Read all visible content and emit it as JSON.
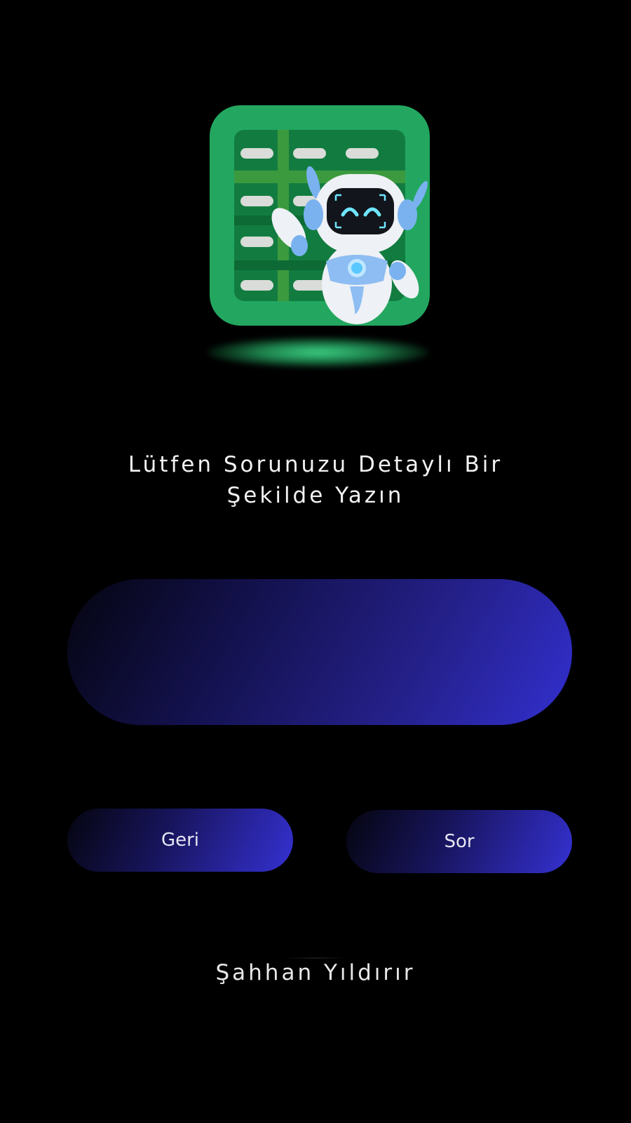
{
  "logo": {
    "icon": "spreadsheet-robot-icon",
    "colors": {
      "tile": "#23a760",
      "sheet": "#127c40",
      "cells": "#d9dcd8",
      "robot_body": "#e8ecf2",
      "robot_accent": "#7ab2f0",
      "glow": "#3ddc8a"
    }
  },
  "title": {
    "line1": "Lütfen Sorunuzu Detaylı Bir",
    "line2": "Şekilde Yazın"
  },
  "question_input": {
    "value": "",
    "placeholder": ""
  },
  "buttons": {
    "back_label": "Geri",
    "ask_label": "Sor"
  },
  "footer": {
    "author": "Şahhan Yıldırır"
  },
  "theme": {
    "background": "#000000",
    "gradient_start": "#05050f",
    "gradient_end": "#3431d0",
    "text": "#f2f2f2"
  }
}
